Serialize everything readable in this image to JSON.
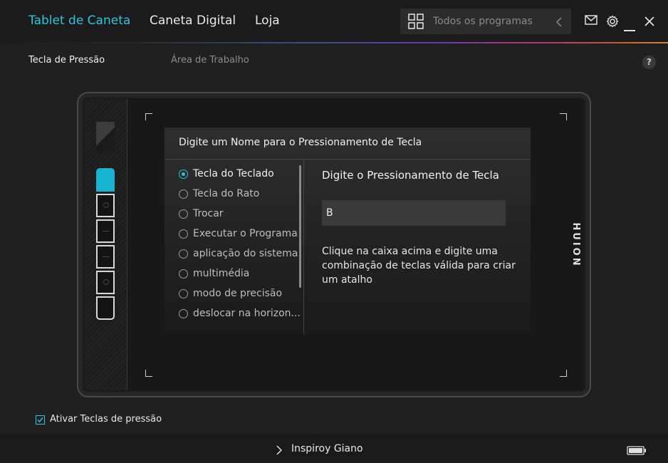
{
  "nav": {
    "tabs": [
      {
        "label": "Tablet de Caneta",
        "active": true
      },
      {
        "label": "Caneta Digital",
        "active": false
      },
      {
        "label": "Loja",
        "active": false
      }
    ],
    "search_placeholder": "Todos os programas",
    "accent_color": "#2fc4e0"
  },
  "subtabs": [
    {
      "label": "Tecla de Pressão",
      "active": true
    },
    {
      "label": "Área de Trabalho",
      "active": false
    }
  ],
  "help_label": "?",
  "tablet": {
    "brand": "HUION",
    "express_keys_count": 6,
    "selected_key_index": 0
  },
  "dialog": {
    "title": "Digite um Nome para o Pressionamento de Tecla",
    "options": [
      {
        "label": "Tecla do Teclado",
        "selected": true
      },
      {
        "label": "Tecla do Rato",
        "selected": false
      },
      {
        "label": "Trocar",
        "selected": false
      },
      {
        "label": "Executar o Programa",
        "selected": false
      },
      {
        "label": "aplicação do sistema",
        "selected": false
      },
      {
        "label": "multimédia",
        "selected": false
      },
      {
        "label": "modo de precisão",
        "selected": false
      },
      {
        "label": "deslocar na horizon...",
        "selected": false
      }
    ],
    "right_title": "Digite o Pressionamento de Tecla",
    "key_value": "B",
    "hint": "Clique na caixa acima e digite uma combinação de teclas válida para criar um atalho"
  },
  "enable_keys": {
    "label": "Ativar Teclas de pressão",
    "checked": true
  },
  "footer": {
    "device": "Inspiroy Giano"
  }
}
